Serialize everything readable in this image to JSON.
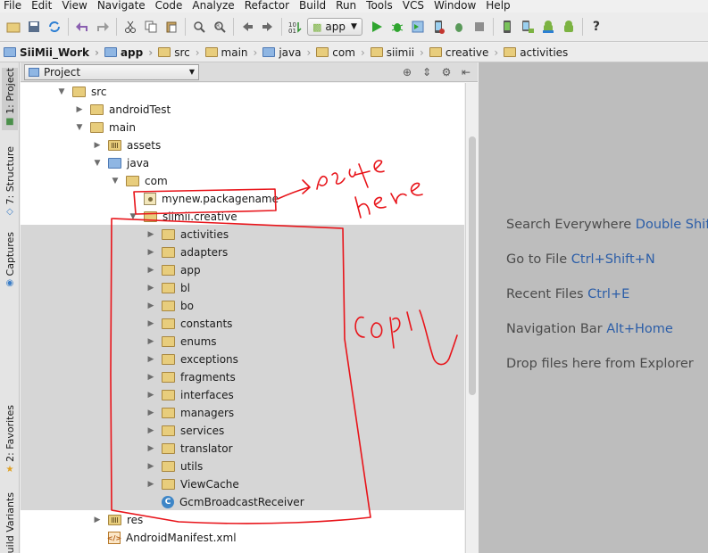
{
  "menu": [
    "File",
    "Edit",
    "View",
    "Navigate",
    "Code",
    "Analyze",
    "Refactor",
    "Build",
    "Run",
    "Tools",
    "VCS",
    "Window",
    "Help"
  ],
  "toolbar": {
    "run_config": "app",
    "icons": [
      "open-folder-icon",
      "save-icon",
      "sync-icon",
      "undo-icon",
      "redo-icon",
      "cut-icon",
      "copy-icon",
      "paste-icon",
      "find-icon",
      "replace-icon",
      "back-icon",
      "forward-icon",
      "make-icon",
      "run-icon",
      "debug-icon",
      "attach-icon",
      "stop-icon",
      "avd-icon",
      "sdk-icon",
      "help-icon"
    ]
  },
  "breadcrumb": [
    "SiiMii_Work",
    "app",
    "src",
    "main",
    "java",
    "com",
    "siimii",
    "creative",
    "activities"
  ],
  "left_tabs": {
    "project": "1: Project",
    "structure": "7: Structure",
    "captures": "Captures",
    "favorites": "2: Favorites",
    "build_variants": "Build Variants"
  },
  "panel": {
    "view_mode": "Project"
  },
  "tree": {
    "src": "src",
    "androidTest": "androidTest",
    "main": "main",
    "assets": "assets",
    "java": "java",
    "com": "com",
    "mynew": "mynew.packagename",
    "siimii_creative": "siimii.creative",
    "children": [
      "activities",
      "adapters",
      "app",
      "bl",
      "bo",
      "constants",
      "enums",
      "exceptions",
      "fragments",
      "interfaces",
      "managers",
      "services",
      "translator",
      "utils",
      "ViewCache"
    ],
    "gcm": "GcmBroadcastReceiver",
    "res": "res",
    "manifest": "AndroidManifest.xml"
  },
  "editor_hints": [
    {
      "text": "Search Everywhere",
      "key": "Double Shift"
    },
    {
      "text": "Go to File",
      "key": "Ctrl+Shift+N"
    },
    {
      "text": "Recent Files",
      "key": "Ctrl+E"
    },
    {
      "text": "Navigation Bar",
      "key": "Alt+Home"
    },
    {
      "text": "Drop files here from Explorer",
      "key": ""
    }
  ],
  "colors": {
    "annotation": "#e8141a",
    "accent_key": "#2c5ea8",
    "selection_gray": "#d6d6d6"
  }
}
